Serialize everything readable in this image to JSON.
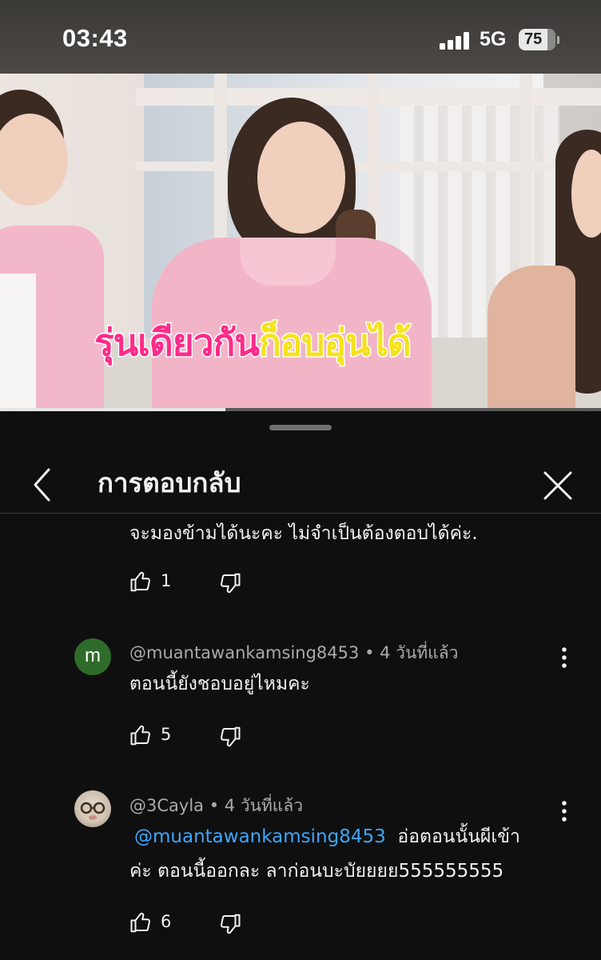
{
  "status_bar": {
    "time": "03:43",
    "network": "5G",
    "battery": "75"
  },
  "video": {
    "caption_part1": "รุ่นเดียวกัน",
    "caption_part2": "ก็อบอุ่นได้",
    "progress": 0.375
  },
  "replies_panel": {
    "title": "การตอบกลับ",
    "comments": [
      {
        "text": "จะมองข้ามได้นะคะ ไม่จำเป็นต้องตอบได้ค่ะ.",
        "likes": "1"
      },
      {
        "avatar_letter": "m",
        "author": "@muantawankamsing8453",
        "time": "4 วันที่แล้ว",
        "text": "ตอนนี้ยังชอบอยู่ไหมคะ",
        "likes": "5"
      },
      {
        "author": "@3Cayla",
        "time": "4 วันที่แล้ว",
        "mention": "@muantawankamsing8453",
        "text_line1": "อ่อตอนนั้นผีเข้า",
        "text_line2": "ค่ะ ตอนนี้ออกละ ลาก่อนบะบัยยยย555555555",
        "likes": "6"
      }
    ]
  },
  "icons": {
    "back": "chevron-left-icon",
    "close": "close-icon",
    "like": "thumbs-up-icon",
    "dislike": "thumbs-down-icon",
    "more": "more-vertical-icon"
  },
  "colors": {
    "background": "#0f0f0f",
    "mention": "#3ea6ff",
    "avatar_m": "#2f6b2b"
  }
}
